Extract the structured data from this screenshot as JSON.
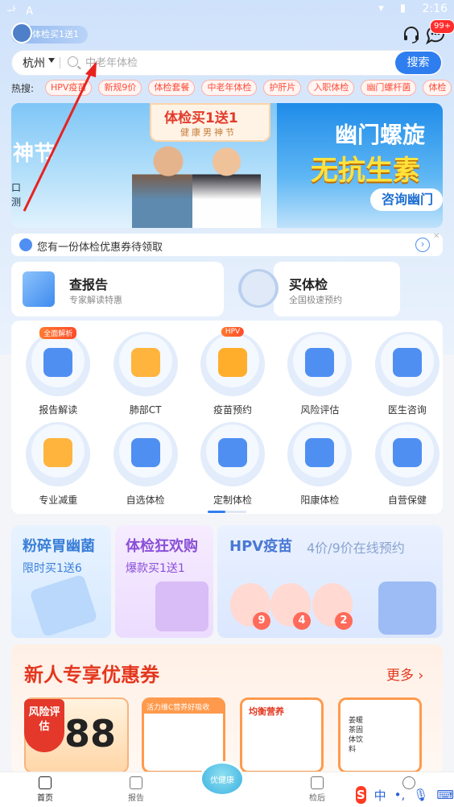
{
  "status_bar": {
    "time": "2:16",
    "left_icons": "ᆉ A"
  },
  "header": {
    "promo_pill": "体检买1送1",
    "message_badge": "99+"
  },
  "search": {
    "city": "杭州",
    "placeholder": "中老年体检",
    "button": "搜索"
  },
  "hot": {
    "label": "热搜:",
    "tags": [
      "HPV疫苗",
      "新规9价",
      "体检套餐",
      "中老年体检",
      "护肝片",
      "入职体检",
      "幽门螺杆菌",
      "体检"
    ]
  },
  "banner": {
    "left_vertical": "神节",
    "left_small": "口 测",
    "tag_title": "体检买1送1",
    "tag_sub": "健康男神节",
    "right_line1": "幽门螺旋",
    "right_line2": "无抗生素",
    "right_button": "咨询幽门"
  },
  "coupon_notice": {
    "text": "您有一份体检优惠券待领取"
  },
  "cards": {
    "report": {
      "title": "查报告",
      "sub": "专家解读特惠"
    },
    "buy": {
      "title": "买体检",
      "sub": "全国极速预约"
    }
  },
  "grid": {
    "row1": [
      {
        "label": "报告解读",
        "badge": "全面解析",
        "icon": "doctor-icon",
        "color": "#4f8ff2"
      },
      {
        "label": "肺部CT",
        "badge": "",
        "icon": "lungs-icon",
        "color": "#ffb43d"
      },
      {
        "label": "疫苗预约",
        "badge": "HPV",
        "icon": "vaccine-bottle-icon",
        "color": "#ffae2b"
      },
      {
        "label": "风险评估",
        "badge": "",
        "icon": "shield-search-icon",
        "color": "#4f8ff2"
      },
      {
        "label": "医生咨询",
        "badge": "",
        "icon": "chat-shield-icon",
        "color": "#4f8ff2"
      }
    ],
    "row2": [
      {
        "label": "专业减重",
        "icon": "gift-box-icon",
        "color": "#ffb43d"
      },
      {
        "label": "自选体检",
        "icon": "medical-kit-check-icon",
        "color": "#4f8ff2"
      },
      {
        "label": "定制体检",
        "icon": "medical-kit-pen-icon",
        "color": "#4f8ff2"
      },
      {
        "label": "阳康体检",
        "icon": "shield-pill-icon",
        "color": "#4f8ff2"
      },
      {
        "label": "自营保健",
        "icon": "supplement-bottle-icon",
        "color": "#4f8ff2"
      }
    ]
  },
  "promos": {
    "p1": {
      "title": "粉碎胃幽菌",
      "sub": "限时买1送6"
    },
    "p2": {
      "title": "体检狂欢购",
      "sub": "爆款买1送1"
    },
    "p3": {
      "title": "HPV疫苗",
      "sub": "4价/9价在线预约",
      "doses": [
        "9",
        "4",
        "2"
      ]
    }
  },
  "newuser": {
    "title": "新人专享优惠券",
    "more": "更多",
    "coupon_value": "588",
    "risk_badge": "风险评估",
    "products": [
      "活力维C营养好吸收",
      "均衡营养",
      "姜暖茶固体饮料"
    ]
  },
  "bottom_nav": {
    "home": "首页",
    "report": "报告",
    "center": "优健康",
    "after": "检后",
    "me": ""
  },
  "ime": {
    "logo": "S",
    "lang": "中",
    "punct": "•,"
  },
  "colors": {
    "accent": "#2f7ef0",
    "hot": "#ff4d3a",
    "newuser": "#e4371f"
  }
}
